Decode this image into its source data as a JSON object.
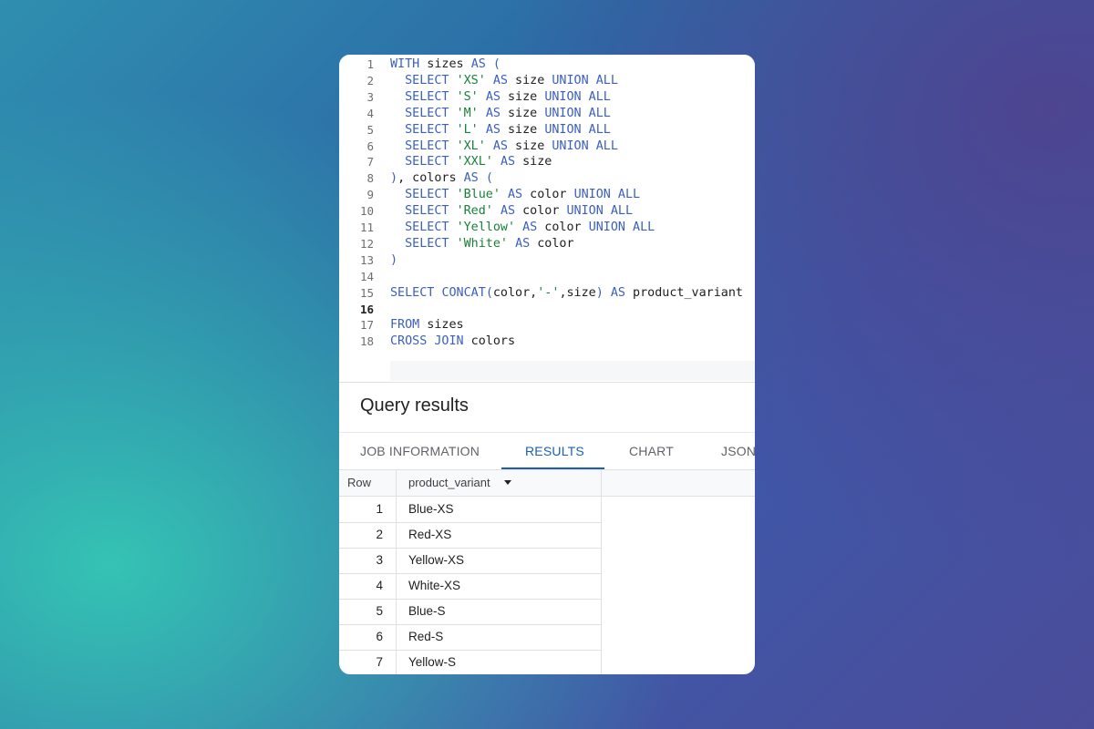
{
  "editor": {
    "active_line": 16,
    "lines": [
      {
        "n": "1",
        "tokens": [
          [
            "kw",
            "WITH"
          ],
          [
            "id",
            " sizes "
          ],
          [
            "kw",
            "AS"
          ],
          [
            "id",
            " "
          ],
          [
            "pn",
            "("
          ]
        ]
      },
      {
        "n": "2",
        "tokens": [
          [
            "id",
            "  "
          ],
          [
            "kw",
            "SELECT"
          ],
          [
            "id",
            " "
          ],
          [
            "str",
            "'XS'"
          ],
          [
            "id",
            " "
          ],
          [
            "kw",
            "AS"
          ],
          [
            "id",
            " size "
          ],
          [
            "kw",
            "UNION ALL"
          ]
        ]
      },
      {
        "n": "3",
        "tokens": [
          [
            "id",
            "  "
          ],
          [
            "kw",
            "SELECT"
          ],
          [
            "id",
            " "
          ],
          [
            "str",
            "'S'"
          ],
          [
            "id",
            " "
          ],
          [
            "kw",
            "AS"
          ],
          [
            "id",
            " size "
          ],
          [
            "kw",
            "UNION ALL"
          ]
        ]
      },
      {
        "n": "4",
        "tokens": [
          [
            "id",
            "  "
          ],
          [
            "kw",
            "SELECT"
          ],
          [
            "id",
            " "
          ],
          [
            "str",
            "'M'"
          ],
          [
            "id",
            " "
          ],
          [
            "kw",
            "AS"
          ],
          [
            "id",
            " size "
          ],
          [
            "kw",
            "UNION ALL"
          ]
        ]
      },
      {
        "n": "5",
        "tokens": [
          [
            "id",
            "  "
          ],
          [
            "kw",
            "SELECT"
          ],
          [
            "id",
            " "
          ],
          [
            "str",
            "'L'"
          ],
          [
            "id",
            " "
          ],
          [
            "kw",
            "AS"
          ],
          [
            "id",
            " size "
          ],
          [
            "kw",
            "UNION ALL"
          ]
        ]
      },
      {
        "n": "6",
        "tokens": [
          [
            "id",
            "  "
          ],
          [
            "kw",
            "SELECT"
          ],
          [
            "id",
            " "
          ],
          [
            "str",
            "'XL'"
          ],
          [
            "id",
            " "
          ],
          [
            "kw",
            "AS"
          ],
          [
            "id",
            " size "
          ],
          [
            "kw",
            "UNION ALL"
          ]
        ]
      },
      {
        "n": "7",
        "tokens": [
          [
            "id",
            "  "
          ],
          [
            "kw",
            "SELECT"
          ],
          [
            "id",
            " "
          ],
          [
            "str",
            "'XXL'"
          ],
          [
            "id",
            " "
          ],
          [
            "kw",
            "AS"
          ],
          [
            "id",
            " size"
          ]
        ]
      },
      {
        "n": "8",
        "tokens": [
          [
            "pn",
            ")"
          ],
          [
            "id",
            ", colors "
          ],
          [
            "kw",
            "AS"
          ],
          [
            "id",
            " "
          ],
          [
            "pn",
            "("
          ]
        ]
      },
      {
        "n": "9",
        "tokens": [
          [
            "id",
            "  "
          ],
          [
            "kw",
            "SELECT"
          ],
          [
            "id",
            " "
          ],
          [
            "str",
            "'Blue'"
          ],
          [
            "id",
            " "
          ],
          [
            "kw",
            "AS"
          ],
          [
            "id",
            " color "
          ],
          [
            "kw",
            "UNION ALL"
          ]
        ]
      },
      {
        "n": "10",
        "tokens": [
          [
            "id",
            "  "
          ],
          [
            "kw",
            "SELECT"
          ],
          [
            "id",
            " "
          ],
          [
            "str",
            "'Red'"
          ],
          [
            "id",
            " "
          ],
          [
            "kw",
            "AS"
          ],
          [
            "id",
            " color "
          ],
          [
            "kw",
            "UNION ALL"
          ]
        ]
      },
      {
        "n": "11",
        "tokens": [
          [
            "id",
            "  "
          ],
          [
            "kw",
            "SELECT"
          ],
          [
            "id",
            " "
          ],
          [
            "str",
            "'Yellow'"
          ],
          [
            "id",
            " "
          ],
          [
            "kw",
            "AS"
          ],
          [
            "id",
            " color "
          ],
          [
            "kw",
            "UNION ALL"
          ]
        ]
      },
      {
        "n": "12",
        "tokens": [
          [
            "id",
            "  "
          ],
          [
            "kw",
            "SELECT"
          ],
          [
            "id",
            " "
          ],
          [
            "str",
            "'White'"
          ],
          [
            "id",
            " "
          ],
          [
            "kw",
            "AS"
          ],
          [
            "id",
            " color"
          ]
        ]
      },
      {
        "n": "13",
        "tokens": [
          [
            "pn",
            ")"
          ]
        ]
      },
      {
        "n": "14",
        "tokens": []
      },
      {
        "n": "15",
        "tokens": [
          [
            "kw",
            "SELECT"
          ],
          [
            "id",
            " "
          ],
          [
            "kw",
            "CONCAT"
          ],
          [
            "pn",
            "("
          ],
          [
            "id",
            "color,"
          ],
          [
            "str",
            "'-'"
          ],
          [
            "id",
            ",size"
          ],
          [
            "pn",
            ")"
          ],
          [
            "id",
            " "
          ],
          [
            "kw",
            "AS"
          ],
          [
            "id",
            " product_variant"
          ]
        ]
      },
      {
        "n": "16",
        "tokens": []
      },
      {
        "n": "17",
        "tokens": [
          [
            "kw",
            "FROM"
          ],
          [
            "id",
            " sizes"
          ]
        ]
      },
      {
        "n": "18",
        "tokens": [
          [
            "kw",
            "CROSS JOIN"
          ],
          [
            "id",
            " colors"
          ]
        ]
      }
    ]
  },
  "results": {
    "title": "Query results",
    "tabs": [
      {
        "label": "JOB INFORMATION",
        "active": false
      },
      {
        "label": "RESULTS",
        "active": true
      },
      {
        "label": "CHART",
        "active": false
      },
      {
        "label": "JSON",
        "active": false
      }
    ],
    "table": {
      "row_header": "Row",
      "column_header": "product_variant",
      "rows": [
        {
          "row": "1",
          "value": "Blue-XS"
        },
        {
          "row": "2",
          "value": "Red-XS"
        },
        {
          "row": "3",
          "value": "Yellow-XS"
        },
        {
          "row": "4",
          "value": "White-XS"
        },
        {
          "row": "5",
          "value": "Blue-S"
        },
        {
          "row": "6",
          "value": "Red-S"
        },
        {
          "row": "7",
          "value": "Yellow-S"
        }
      ]
    }
  },
  "colors": {
    "keyword": "#3a5fbf",
    "string": "#188038",
    "active_tab": "#1a5fb4"
  }
}
